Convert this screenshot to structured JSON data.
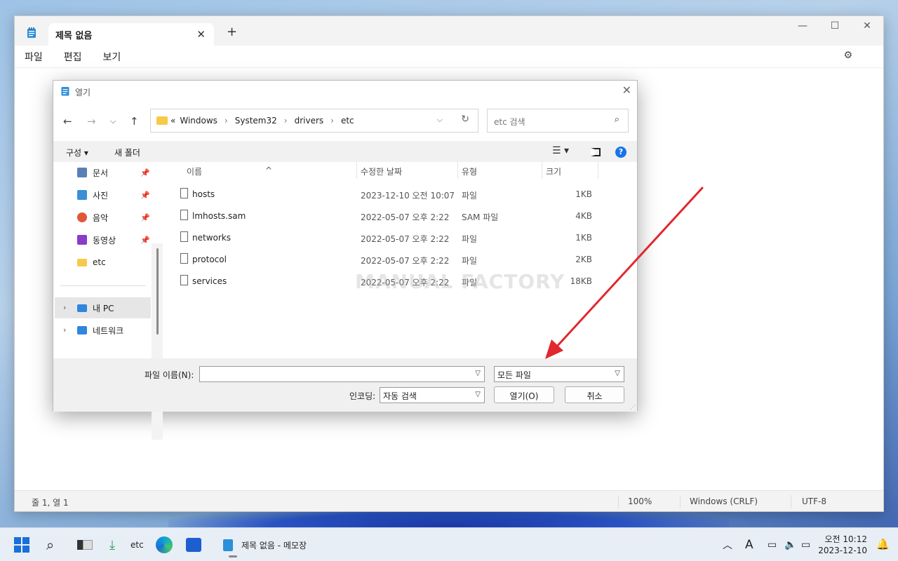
{
  "notepad": {
    "tab_title": "제목 없음",
    "tab_close": "✕",
    "new_tab": "+",
    "menu": [
      "파일",
      "편집",
      "보기"
    ],
    "window_controls": {
      "minimize": "—",
      "maximize": "☐",
      "close": "✕"
    },
    "status": {
      "position": "줄 1, 열 1",
      "zoom": "100%",
      "line_ending": "Windows (CRLF)",
      "encoding": "UTF-8"
    }
  },
  "dialog": {
    "title": "열기",
    "close": "✕",
    "breadcrumb": [
      "«",
      "Windows",
      "System32",
      "drivers",
      "etc"
    ],
    "search_placeholder": "etc 검색",
    "toolbar": {
      "organize": "구성 ▾",
      "new_folder": "새 폴더",
      "help": "?"
    },
    "nav_items": [
      {
        "label": "문서",
        "color": "#5b7fb5",
        "pinned": true
      },
      {
        "label": "사진",
        "color": "#3a8fd6",
        "pinned": true
      },
      {
        "label": "음악",
        "color": "#e0573a",
        "pinned": true
      },
      {
        "label": "동영상",
        "color": "#8a3bc9",
        "pinned": true
      },
      {
        "label": "etc",
        "color": "#f7c948",
        "pinned": false
      }
    ],
    "nav_tree": [
      {
        "label": "내 PC",
        "color": "#2e86de"
      },
      {
        "label": "네트워크",
        "color": "#2e86de"
      }
    ],
    "columns": [
      "이름",
      "수정한 날짜",
      "유형",
      "크기"
    ],
    "files": [
      {
        "name": "hosts",
        "date": "2023-12-10 오전 10:07",
        "type": "파일",
        "size": "1KB"
      },
      {
        "name": "lmhosts.sam",
        "date": "2022-05-07 오후 2:22",
        "type": "SAM 파일",
        "size": "4KB"
      },
      {
        "name": "networks",
        "date": "2022-05-07 오후 2:22",
        "type": "파일",
        "size": "1KB"
      },
      {
        "name": "protocol",
        "date": "2022-05-07 오후 2:22",
        "type": "파일",
        "size": "2KB"
      },
      {
        "name": "services",
        "date": "2022-05-07 오후 2:22",
        "type": "파일",
        "size": "18KB"
      }
    ],
    "watermark": "MANUAL FACTORY",
    "filename_label": "파일 이름(N):",
    "filename_value": "",
    "filetype_value": "모든 파일",
    "encoding_label": "인코딩:",
    "encoding_value": "자동 검색",
    "open_button": "열기(O)",
    "cancel_button": "취소"
  },
  "taskbar": {
    "etc_label": "etc",
    "notepad_label": "제목 없음 - 메모장",
    "clock_time": "오전 10:12",
    "clock_date": "2023-12-10"
  },
  "colors": {
    "arrow": "#e0282e",
    "accent": "#1a73e8"
  }
}
